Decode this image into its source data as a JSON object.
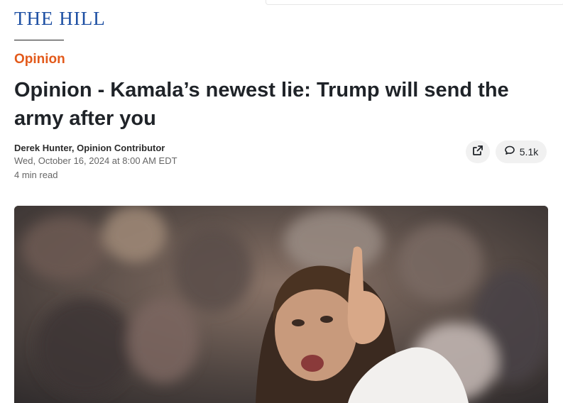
{
  "site": {
    "logo": "THE HILL"
  },
  "article": {
    "section": "Opinion",
    "headline": "Opinion - Kamala’s newest lie: Trump will send the army after you",
    "author": "Derek Hunter, Opinion Contributor",
    "date": "Wed, October 16, 2024 at 8:00 AM EDT",
    "read_time": "4 min read"
  },
  "actions": {
    "share_icon": "external-link-icon",
    "comment_icon": "speech-bubble-icon",
    "comment_count": "5.1k"
  },
  "colors": {
    "logo_blue": "#1d4fa3",
    "section_orange": "#e35a1b",
    "headline": "#1f2328"
  }
}
